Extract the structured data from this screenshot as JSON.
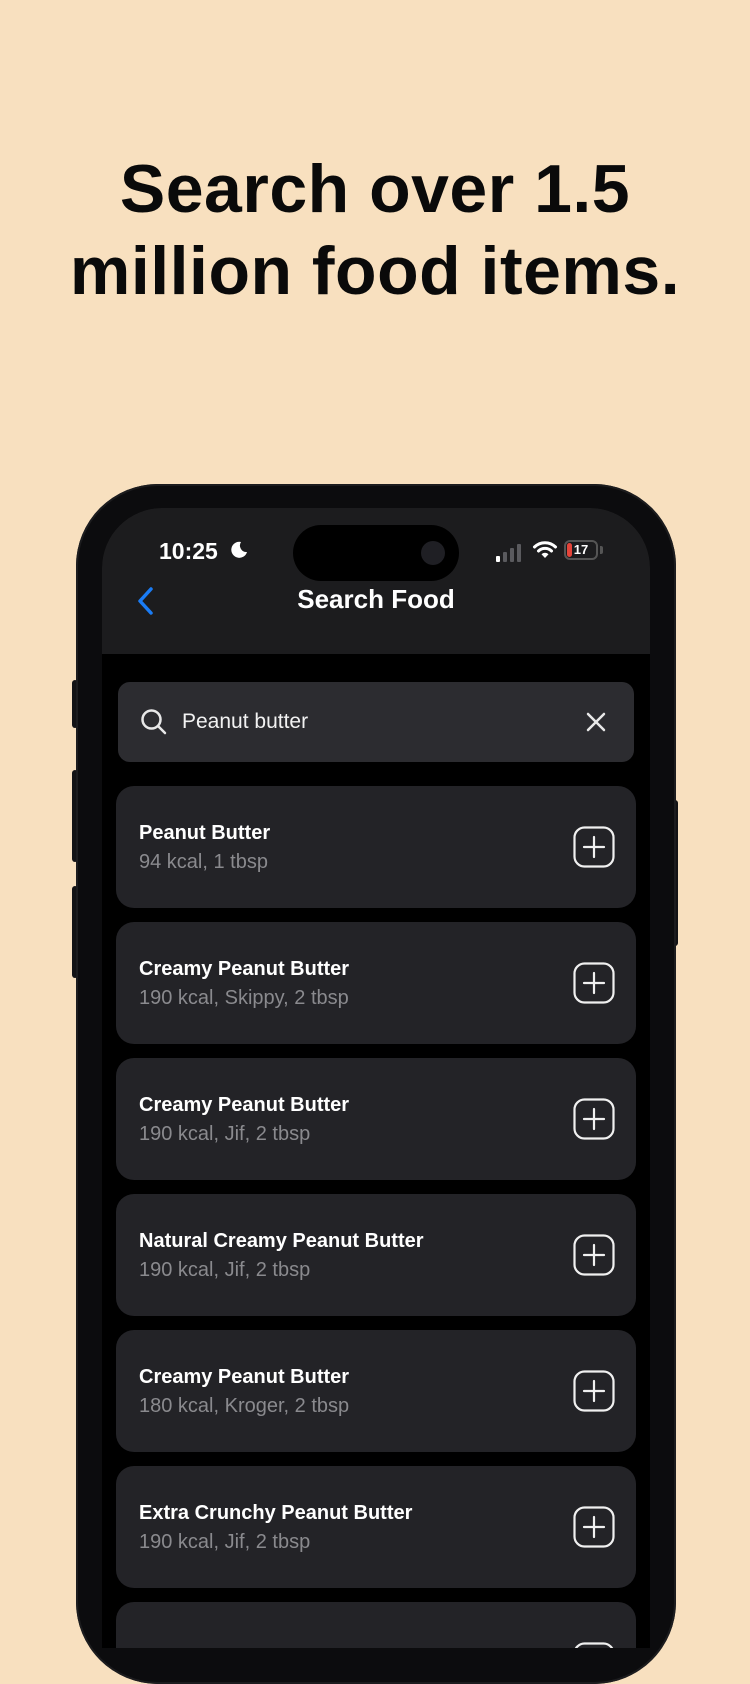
{
  "headline": {
    "line1": "Search over 1.5",
    "line2": "million food items."
  },
  "status_bar": {
    "time": "10:25",
    "battery": "17",
    "battery_color": "#e5443a"
  },
  "nav": {
    "title": "Search Food",
    "back_icon": "chevron-left-icon",
    "accent": "#1a7cf5"
  },
  "search": {
    "value": "Peanut butter",
    "icon": "search-icon",
    "clear_icon": "close-icon"
  },
  "results": [
    {
      "name": "Peanut Butter",
      "detail": "94 kcal, 1 tbsp"
    },
    {
      "name": "Creamy Peanut Butter",
      "detail": "190 kcal, Skippy, 2 tbsp"
    },
    {
      "name": "Creamy Peanut Butter",
      "detail": "190 kcal, Jif, 2 tbsp"
    },
    {
      "name": "Natural Creamy Peanut Butter",
      "detail": "190 kcal, Jif, 2 tbsp"
    },
    {
      "name": "Creamy Peanut Butter",
      "detail": "180 kcal, Kroger, 2 tbsp"
    },
    {
      "name": "Extra Crunchy Peanut Butter",
      "detail": "190 kcal, Jif, 2 tbsp"
    },
    {
      "name": "",
      "detail": ""
    }
  ]
}
